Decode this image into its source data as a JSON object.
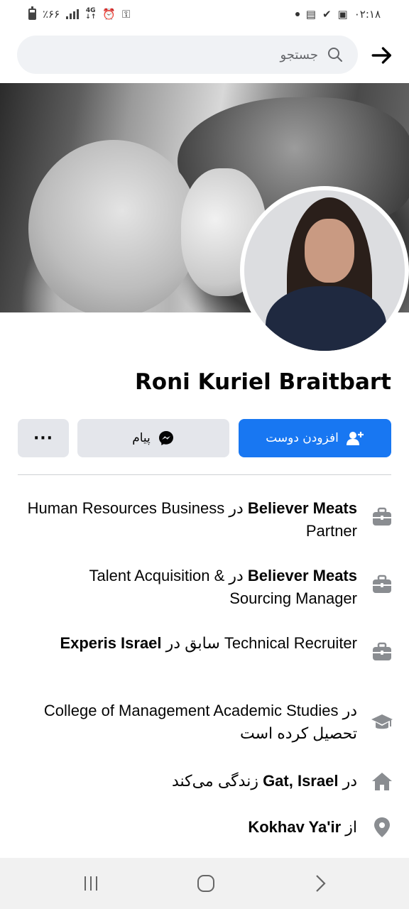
{
  "status_bar": {
    "time": "۰۲:۱۸",
    "battery": "٪۶۶",
    "network": "4G"
  },
  "search": {
    "placeholder": "جستجو"
  },
  "profile": {
    "name": "Roni Kuriel Braitbart"
  },
  "actions": {
    "add_friend": "افزودن دوست",
    "message": "پیام",
    "more": "···"
  },
  "details": [
    {
      "icon": "briefcase-icon",
      "parts": [
        {
          "t": "Human Resources Business Partner"
        },
        {
          "t": " در "
        },
        {
          "t": "Believer Meats",
          "b": true
        }
      ]
    },
    {
      "icon": "briefcase-icon",
      "parts": [
        {
          "t": "Talent Acquisition & Sourcing Manager"
        },
        {
          "t": " در "
        },
        {
          "t": "Believer Meats",
          "b": true
        }
      ]
    },
    {
      "icon": "briefcase-icon",
      "parts": [
        {
          "t": "Technical Recruiter"
        },
        {
          "t": " سابق در "
        },
        {
          "t": "Experis Israel",
          "b": true
        }
      ]
    },
    {
      "icon": "graduation-cap-icon",
      "parts": [
        {
          "t": "در "
        },
        {
          "t": "College of Management Academic Studies"
        },
        {
          "t": " تحصیل کرده است"
        }
      ]
    },
    {
      "icon": "home-icon",
      "parts": [
        {
          "t": "در "
        },
        {
          "t": "Gat, Israel",
          "b": true
        },
        {
          "t": " زندگی می‌کند"
        }
      ]
    },
    {
      "icon": "location-pin-icon",
      "parts": [
        {
          "t": "از "
        },
        {
          "t": "Kokhav Ya'ir",
          "b": true
        }
      ]
    }
  ],
  "colors": {
    "primary": "#1877f2",
    "secondary_button": "#e4e6eb",
    "icon_gray": "#8a8d91"
  }
}
